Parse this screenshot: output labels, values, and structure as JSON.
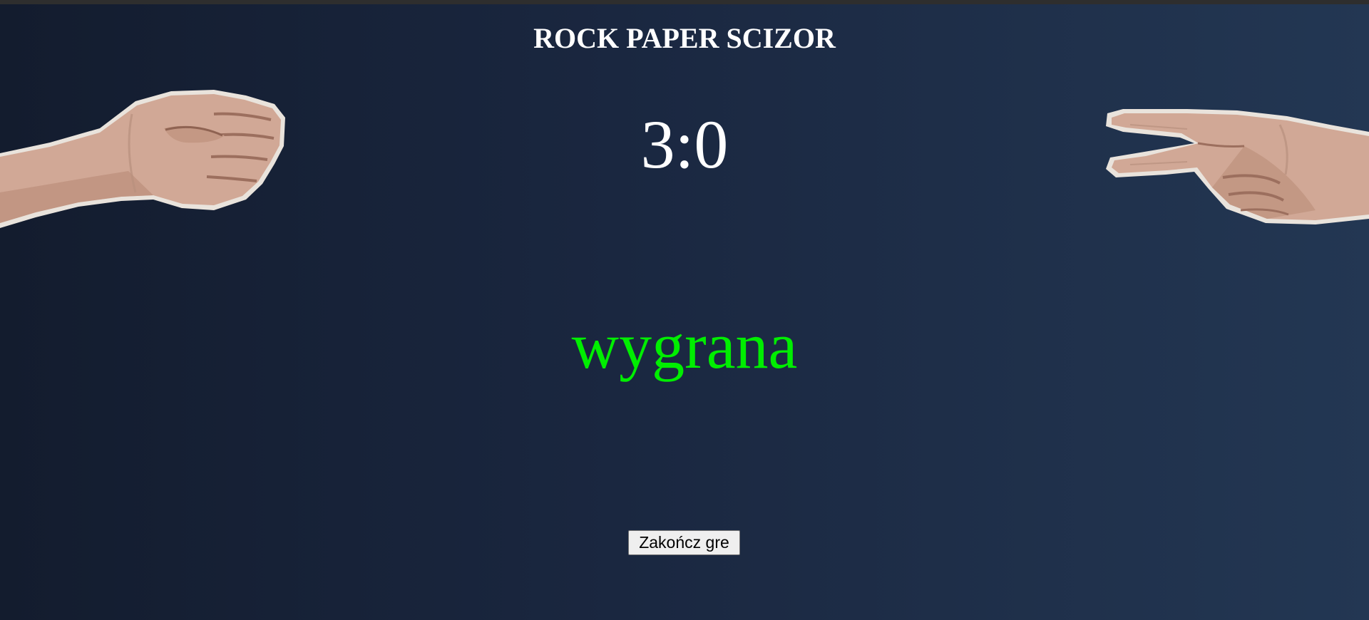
{
  "game": {
    "title": "ROCK PAPER SCIZOR",
    "score": "3:0",
    "result": "wygrana",
    "end_button_label": "Zakończ gre"
  },
  "players": {
    "left_hand": "rock-hand-icon",
    "right_hand": "scissors-hand-icon"
  },
  "colors": {
    "background_left": "#131c2e",
    "background_right": "#233753",
    "title": "#ffffff",
    "score": "#ffffff",
    "result": "#00ee00",
    "button_bg": "#efefef"
  }
}
